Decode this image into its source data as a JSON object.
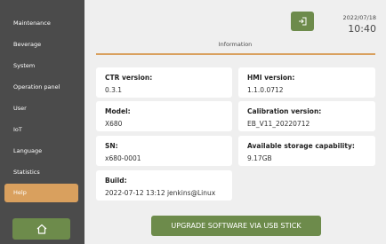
{
  "sidebar": {
    "items": [
      {
        "label": "Maintenance",
        "active": false
      },
      {
        "label": "Beverage",
        "active": false
      },
      {
        "label": "System",
        "active": false
      },
      {
        "label": "Operation panel",
        "active": false
      },
      {
        "label": "User",
        "active": false
      },
      {
        "label": "IoT",
        "active": false
      },
      {
        "label": "Language",
        "active": false
      },
      {
        "label": "Statistics",
        "active": false
      },
      {
        "label": "Help",
        "active": true
      }
    ],
    "home_icon": "home-icon"
  },
  "header": {
    "date": "2022/07/18",
    "time": "10:40",
    "logout_icon": "logout-icon"
  },
  "section": {
    "title": "Information"
  },
  "info": {
    "ctr": {
      "label": "CTR version:",
      "value": "0.3.1"
    },
    "hmi": {
      "label": "HMI version:",
      "value": "1.1.0.0712"
    },
    "model": {
      "label": "Model:",
      "value": "X680"
    },
    "calibration": {
      "label": "Calibration version:",
      "value": "EB_V11_20220712"
    },
    "sn": {
      "label": "SN:",
      "value": "x680-0001"
    },
    "storage": {
      "label": "Available storage capability:",
      "value": "9.17GB"
    },
    "build": {
      "label": "Build:",
      "value": "2022-07-12 13:12 jenkins@Linux"
    }
  },
  "actions": {
    "upgrade_label": "UPGRADE SOFTWARE VIA USB STICK"
  },
  "colors": {
    "accent": "#d9a05e",
    "button": "#6d8b4b",
    "sidebar": "#4b4b4b"
  }
}
